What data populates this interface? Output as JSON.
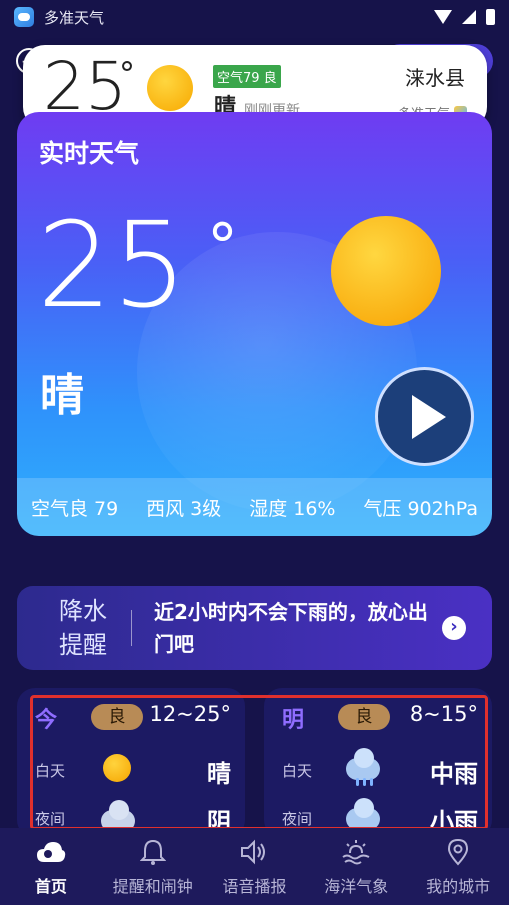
{
  "status_bar": {
    "app_name": "多准天气"
  },
  "floating_card": {
    "temp": "25",
    "deg": "°",
    "aqi": "空气79 良",
    "condition": "晴",
    "update": "刚刚更新",
    "city": "涞水县",
    "brand": "多准天气"
  },
  "realtime": {
    "title": "实时天气",
    "temp": "25",
    "deg": "°",
    "condition": "晴",
    "metrics": [
      "空气良 79",
      "西风 3级",
      "湿度 16%",
      "气压 902hPa"
    ]
  },
  "rain": {
    "tag_line1": "降水",
    "tag_line2": "提醒",
    "text": "近2小时内不会下雨的，放心出门吧",
    "arrow": "›"
  },
  "forecast": {
    "today": {
      "label": "今",
      "aqi": "良",
      "range": "12~25°",
      "day_label": "白天",
      "day_cond": "晴",
      "night_label": "夜间",
      "night_cond": "阴"
    },
    "tomorrow": {
      "label": "明",
      "aqi": "良",
      "range": "8~15°",
      "day_label": "白天",
      "day_cond": "中雨",
      "night_label": "夜间",
      "night_cond": "小雨"
    }
  },
  "nav": [
    "首页",
    "提醒和闹钟",
    "语音播报",
    "海洋气象",
    "我的城市"
  ],
  "colors": {
    "accent": "#6f3cf2",
    "aqi_green": "#3aa64b",
    "highlight_red": "#e0302d"
  }
}
